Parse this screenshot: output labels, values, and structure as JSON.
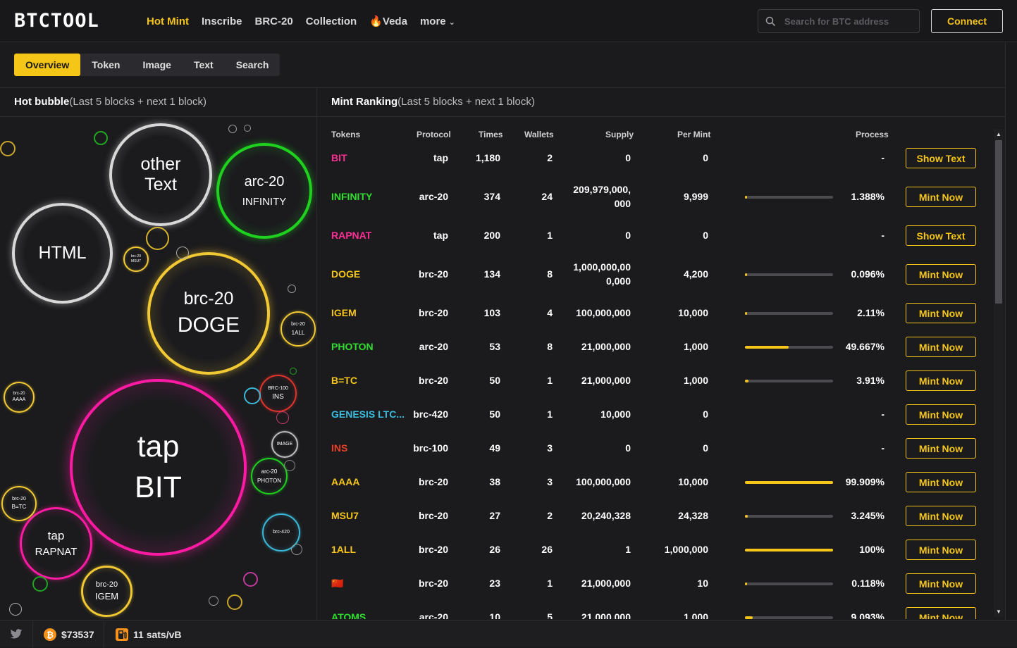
{
  "header": {
    "logo": "BTCTOOL",
    "nav": [
      {
        "label": "Hot Mint",
        "active": true
      },
      {
        "label": "Inscribe"
      },
      {
        "label": "BRC-20"
      },
      {
        "label": "Collection"
      },
      {
        "label": "Veda",
        "icon": "fire-icon"
      },
      {
        "label": "more",
        "icon": "chevron-down-icon"
      }
    ],
    "search_placeholder": "Search for BTC address",
    "connect_label": "Connect"
  },
  "tabs": [
    "Overview",
    "Token",
    "Image",
    "Text",
    "Search"
  ],
  "hot_bubble": {
    "title": "Hot bubble",
    "subtitle": "(Last 5 blocks + next 1 block)",
    "bubbles": [
      {
        "l1": "other",
        "l2": "Text",
        "color": "#d8d8d8"
      },
      {
        "l1": "arc-20",
        "l2": "INFINITY",
        "color": "#1fd11f"
      },
      {
        "l1": "HTML",
        "l2": "",
        "color": "#d8d8d8"
      },
      {
        "l1": "brc-20",
        "l2": "DOGE",
        "color": "#f2c933"
      },
      {
        "l1": "tap",
        "l2": "BIT",
        "color": "#ff1aa3"
      },
      {
        "l1": "tap",
        "l2": "RAPNAT",
        "color": "#ff1aa3"
      },
      {
        "l1": "brc-20",
        "l2": "IGEM",
        "color": "#f2c933"
      },
      {
        "l1": "brc-20",
        "l2": "1ALL",
        "color": "#f2c933"
      },
      {
        "l1": "BRC-100",
        "l2": "INS",
        "color": "#e0332b"
      },
      {
        "l1": "IMAGE",
        "l2": "",
        "color": "#bbbbbb"
      },
      {
        "l1": "arc-20",
        "l2": "PHOTON",
        "color": "#1fd11f"
      },
      {
        "l1": "brc-420",
        "l2": "",
        "color": "#3bb8d8"
      },
      {
        "l1": "brc-20",
        "l2": "AAAA",
        "color": "#f2c933"
      },
      {
        "l1": "brc-20",
        "l2": "B=TC",
        "color": "#f2c933"
      },
      {
        "l1": "brc-20",
        "l2": "MSU7",
        "color": "#f2c933"
      }
    ]
  },
  "mint_ranking": {
    "title": "Mint Ranking",
    "subtitle": "(Last 5 blocks + next 1 block)",
    "columns": [
      "Tokens",
      "Protocol",
      "Times",
      "Wallets",
      "Supply",
      "Per Mint",
      "Process"
    ],
    "rows": [
      {
        "token": "BIT",
        "color": "#ff2e93",
        "protocol": "tap",
        "times": "1,180",
        "wallets": "2",
        "supply": "0",
        "supply2": "",
        "per_mint": "0",
        "progress": null,
        "process": "-",
        "action": "Show Text"
      },
      {
        "token": "INFINITY",
        "color": "#2ee02e",
        "protocol": "arc-20",
        "times": "374",
        "wallets": "24",
        "supply": "209,979,000,",
        "supply2": "000",
        "per_mint": "9,999",
        "progress": 0.01388,
        "process": "1.388%",
        "action": "Mint Now"
      },
      {
        "token": "RAPNAT",
        "color": "#ff2e93",
        "protocol": "tap",
        "times": "200",
        "wallets": "1",
        "supply": "0",
        "supply2": "",
        "per_mint": "0",
        "progress": null,
        "process": "-",
        "action": "Show Text"
      },
      {
        "token": "DOGE",
        "color": "#f5c518",
        "protocol": "brc-20",
        "times": "134",
        "wallets": "8",
        "supply": "1,000,000,00",
        "supply2": "0,000",
        "per_mint": "4,200",
        "progress": 0.00096,
        "process": "0.096%",
        "action": "Mint Now"
      },
      {
        "token": "IGEM",
        "color": "#f5c518",
        "protocol": "brc-20",
        "times": "103",
        "wallets": "4",
        "supply": "100,000,000",
        "supply2": "",
        "per_mint": "10,000",
        "progress": 0.0211,
        "process": "2.11%",
        "action": "Mint Now"
      },
      {
        "token": "PHOTON",
        "color": "#2ee02e",
        "protocol": "arc-20",
        "times": "53",
        "wallets": "8",
        "supply": "21,000,000",
        "supply2": "",
        "per_mint": "1,000",
        "progress": 0.49667,
        "process": "49.667%",
        "action": "Mint Now"
      },
      {
        "token": "B=TC",
        "color": "#f5c518",
        "protocol": "brc-20",
        "times": "50",
        "wallets": "1",
        "supply": "21,000,000",
        "supply2": "",
        "per_mint": "1,000",
        "progress": 0.0391,
        "process": "3.91%",
        "action": "Mint Now"
      },
      {
        "token": "GENESIS LTC...",
        "color": "#3bbde0",
        "protocol": "brc-420",
        "times": "50",
        "wallets": "1",
        "supply": "10,000",
        "supply2": "",
        "per_mint": "0",
        "progress": null,
        "process": "-",
        "action": "Mint Now"
      },
      {
        "token": "INS",
        "color": "#e8402a",
        "protocol": "brc-100",
        "times": "49",
        "wallets": "3",
        "supply": "0",
        "supply2": "",
        "per_mint": "0",
        "progress": null,
        "process": "-",
        "action": "Mint Now"
      },
      {
        "token": "AAAA",
        "color": "#f5c518",
        "protocol": "brc-20",
        "times": "38",
        "wallets": "3",
        "supply": "100,000,000",
        "supply2": "",
        "per_mint": "10,000",
        "progress": 0.99909,
        "process": "99.909%",
        "action": "Mint Now"
      },
      {
        "token": "MSU7",
        "color": "#f5c518",
        "protocol": "brc-20",
        "times": "27",
        "wallets": "2",
        "supply": "20,240,328",
        "supply2": "",
        "per_mint": "24,328",
        "progress": 0.03245,
        "process": "3.245%",
        "action": "Mint Now"
      },
      {
        "token": "1ALL",
        "color": "#f5c518",
        "protocol": "brc-20",
        "times": "26",
        "wallets": "26",
        "supply": "1",
        "supply2": "",
        "per_mint": "1,000,000",
        "progress": 1.0,
        "process": "100%",
        "action": "Mint Now"
      },
      {
        "token": "🇨🇳",
        "color": "#f5c518",
        "protocol": "brc-20",
        "times": "23",
        "wallets": "1",
        "supply": "21,000,000",
        "supply2": "",
        "per_mint": "10",
        "progress": 0.00118,
        "process": "0.118%",
        "action": "Mint Now"
      },
      {
        "token": "ATOMS",
        "color": "#2ee02e",
        "protocol": "arc-20",
        "times": "10",
        "wallets": "5",
        "supply": "21,000,000",
        "supply2": "",
        "per_mint": "1,000",
        "progress": 0.09093,
        "process": "9.093%",
        "action": "Mint Now"
      }
    ]
  },
  "footer": {
    "btc_price": "$73537",
    "fee": "11 sats/vB"
  },
  "colors": {
    "accent": "#f5c518",
    "background": "#1b1b1d"
  }
}
